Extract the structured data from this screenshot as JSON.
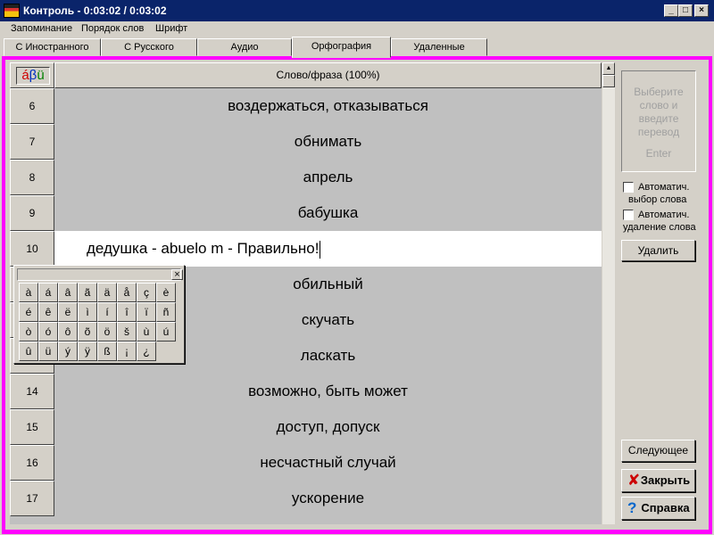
{
  "window": {
    "title": "Контроль - 0:03:02 / 0:03:02",
    "min_glyph": "_",
    "max_glyph": "□",
    "close_glyph": "×"
  },
  "menu": {
    "items": [
      "Запоминание",
      "Порядок слов",
      "Шрифт"
    ]
  },
  "tabs": {
    "items": [
      "С Иностранного",
      "С Русского",
      "Аудио",
      "Орфография",
      "Удаленные"
    ],
    "active": "Орфография"
  },
  "grid": {
    "glyph_label": "áβü",
    "header": "Слово/фраза (100%)",
    "rows": [
      {
        "num": "6",
        "word": "воздержаться, отказываться"
      },
      {
        "num": "7",
        "word": "обнимать"
      },
      {
        "num": "8",
        "word": "апрель"
      },
      {
        "num": "9",
        "word": "бабушка"
      },
      {
        "num": "10",
        "word": "дедушка - abuelo m - Правильно!"
      },
      {
        "num": "",
        "word": "обильный"
      },
      {
        "num": "",
        "word": "скучать"
      },
      {
        "num": "",
        "word": "ласкать"
      },
      {
        "num": "14",
        "word": "возможно, быть может"
      },
      {
        "num": "15",
        "word": "доступ, допуск"
      },
      {
        "num": "16",
        "word": "несчастный случай"
      },
      {
        "num": "17",
        "word": "ускорение"
      }
    ]
  },
  "keyboard": {
    "close_glyph": "×",
    "keys": [
      "à",
      "á",
      "â",
      "ã",
      "ä",
      "å",
      "ç",
      "è",
      "é",
      "ê",
      "ë",
      "ì",
      "í",
      "î",
      "ï",
      "ñ",
      "ò",
      "ó",
      "ô",
      "õ",
      "ö",
      "š",
      "ù",
      "ú",
      "û",
      "ü",
      "ý",
      "ÿ",
      "ß",
      "¡",
      "¿"
    ]
  },
  "sidebar": {
    "hint_line1": "Выберите",
    "hint_line2": "слово и",
    "hint_line3": "введите",
    "hint_line4": "перевод",
    "hint_enter": "Enter",
    "auto_select_line1": "Автоматич.",
    "auto_select_line2": "выбор слова",
    "auto_delete_line1": "Автоматич.",
    "auto_delete_line2": "удаление слова",
    "delete_button": "Удалить",
    "next_button": "Следующее",
    "close_button": "Закрыть",
    "help_button": "Справка"
  },
  "colors": {
    "frame_accent": "#ff00ff",
    "titlebar": "#0a246a",
    "close_icon": "#cc0000",
    "help_icon": "#0066cc"
  }
}
